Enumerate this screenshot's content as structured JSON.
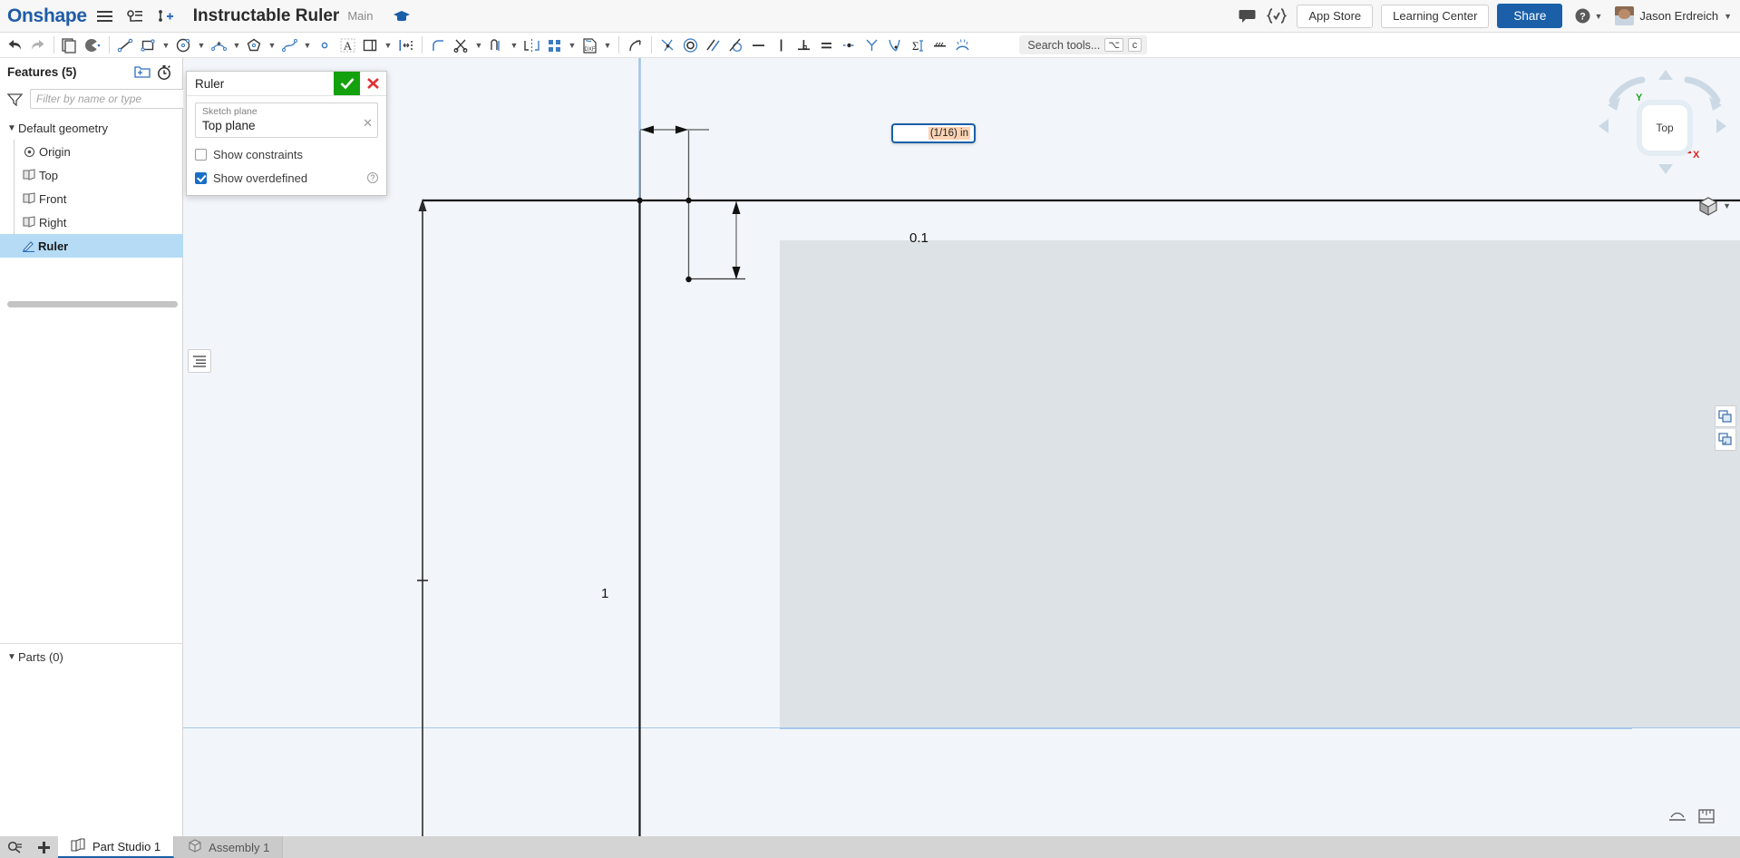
{
  "header": {
    "brand": "Onshape",
    "menu_icon": "hamburger-icon",
    "versions_icon": "version-graph-icon",
    "insert_icon": "add-version-icon",
    "document_title": "Instructable Ruler",
    "branch": "Main",
    "graduation_icon": "graduation-cap-icon",
    "comment_icon": "comment-icon",
    "featurescript_icon": "featurescript-icon",
    "app_store": "App Store",
    "learning_center": "Learning Center",
    "share": "Share",
    "help_icon": "help-icon",
    "user_name": "Jason Erdreich"
  },
  "toolbar": {
    "search_placeholder": "Search tools...",
    "shortcut_alt": "⌥",
    "shortcut_key": "c",
    "items": [
      {
        "name": "undo-icon",
        "label": "Undo"
      },
      {
        "name": "redo-icon",
        "label": "Redo"
      },
      {
        "name": "sketch-icon",
        "label": "Sketch"
      },
      {
        "name": "plane-select-icon",
        "label": "Select plane"
      },
      {
        "name": "line-tool-icon",
        "label": "Line"
      },
      {
        "name": "rectangle-tool-icon",
        "label": "Corner rectangle"
      },
      {
        "name": "circle-tool-icon",
        "label": "Circle"
      },
      {
        "name": "arc-tool-icon",
        "label": "Arc"
      },
      {
        "name": "polygon-tool-icon",
        "label": "Polygon"
      },
      {
        "name": "spline-tool-icon",
        "label": "Spline"
      },
      {
        "name": "point-tool-icon",
        "label": "Point"
      },
      {
        "name": "text-tool-icon",
        "label": "Text"
      },
      {
        "name": "offset-tool-icon",
        "label": "Offset"
      },
      {
        "name": "dimension-tool-icon",
        "label": "Dimension"
      },
      {
        "name": "fillet-tool-icon",
        "label": "Fillet"
      },
      {
        "name": "trim-tool-icon",
        "label": "Trim"
      },
      {
        "name": "extend-tool-icon",
        "label": "Extend"
      },
      {
        "name": "mirror-tool-icon",
        "label": "Mirror"
      },
      {
        "name": "pattern-tool-icon",
        "label": "Linear pattern"
      },
      {
        "name": "dxf-import-icon",
        "label": "Import DXF"
      },
      {
        "name": "transform-tool-icon",
        "label": "Transform"
      },
      {
        "name": "coincident-constraint-icon",
        "label": "Coincident"
      },
      {
        "name": "concentric-constraint-icon",
        "label": "Concentric"
      },
      {
        "name": "parallel-constraint-icon",
        "label": "Parallel"
      },
      {
        "name": "tangent-constraint-icon",
        "label": "Tangent"
      },
      {
        "name": "horizontal-constraint-icon",
        "label": "Horizontal"
      },
      {
        "name": "vertical-constraint-icon",
        "label": "Vertical"
      },
      {
        "name": "perpendicular-constraint-icon",
        "label": "Perpendicular"
      },
      {
        "name": "equal-constraint-icon",
        "label": "Equal"
      },
      {
        "name": "midpoint-constraint-icon",
        "label": "Midpoint"
      },
      {
        "name": "symmetric-constraint-icon",
        "label": "Symmetric"
      },
      {
        "name": "curvature-constraint-icon",
        "label": "Curvature"
      },
      {
        "name": "construction-constraint-icon",
        "label": "Construction"
      },
      {
        "name": "normal-constraint-icon",
        "label": "Normal"
      },
      {
        "name": "arcs-constraint-icon",
        "label": "Arc constraints"
      }
    ]
  },
  "features_panel": {
    "title": "Features (5)",
    "new_folder_icon": "new-folder-icon",
    "rollback_icon": "rollback-timer-icon",
    "filter_icon": "filter-funnel-icon",
    "filter_placeholder": "Filter by name or type",
    "tree": [
      {
        "label": "Default geometry",
        "icon": "chevron-down-icon",
        "level": 0,
        "selected": false
      },
      {
        "label": "Origin",
        "icon": "origin-icon",
        "level": 1,
        "selected": false
      },
      {
        "label": "Top",
        "icon": "plane-icon",
        "level": 1,
        "selected": false
      },
      {
        "label": "Front",
        "icon": "plane-icon",
        "level": 1,
        "selected": false
      },
      {
        "label": "Right",
        "icon": "plane-icon",
        "level": 1,
        "selected": false
      },
      {
        "label": "Ruler",
        "icon": "sketch-feature-icon",
        "level": 0,
        "selected": true
      }
    ],
    "parts_title": "Parts (0)"
  },
  "sketch_dialog": {
    "name": "Ruler",
    "accept_icon": "checkmark-icon",
    "cancel_icon": "close-x-icon",
    "plane_label": "Sketch plane",
    "plane_value": "Top plane",
    "plane_clear_icon": "clear-x-icon",
    "show_constraints_label": "Show constraints",
    "show_constraints_checked": false,
    "show_overdefined_label": "Show overdefined",
    "show_overdefined_checked": true,
    "help_icon": "help-circle-icon"
  },
  "canvas": {
    "dimension_input_value": "(1/16) in",
    "vertical_dimension": "0.1",
    "axis_tick_label": "1",
    "list_button_icon": "feature-list-icon",
    "view_cube": {
      "face_label": "Top",
      "axis_y": "Y",
      "axis_x": "X",
      "up_arrow_icon": "nav-up-arrow-icon",
      "down_arrow_icon": "nav-down-arrow-icon",
      "left_arrow_icon": "nav-left-arrow-icon",
      "right_arrow_icon": "nav-right-arrow-icon",
      "view_mode_icon": "shaded-cube-icon"
    },
    "side_buttons": [
      {
        "name": "display-states-icon"
      },
      {
        "name": "render-mode-icon"
      }
    ],
    "bottom_buttons": [
      {
        "name": "sketch-display-icon"
      },
      {
        "name": "measure-panel-icon"
      }
    ]
  },
  "colors": {
    "brand_blue": "#1f5ba8",
    "share_blue": "#1a5fa8",
    "accept_green": "#13a10e",
    "cancel_red": "#e03131",
    "selection_blue": "#b5dbf5",
    "dim_highlight": "#fbd3b4",
    "axis_x_red": "#e02020",
    "axis_y_green": "#19a519"
  },
  "tabbar": {
    "search_icon": "tab-search-icon",
    "add_icon": "add-tab-icon",
    "tabs": [
      {
        "label": "Part Studio 1",
        "icon": "part-studio-icon",
        "active": true
      },
      {
        "label": "Assembly 1",
        "icon": "assembly-icon",
        "active": false
      }
    ]
  }
}
